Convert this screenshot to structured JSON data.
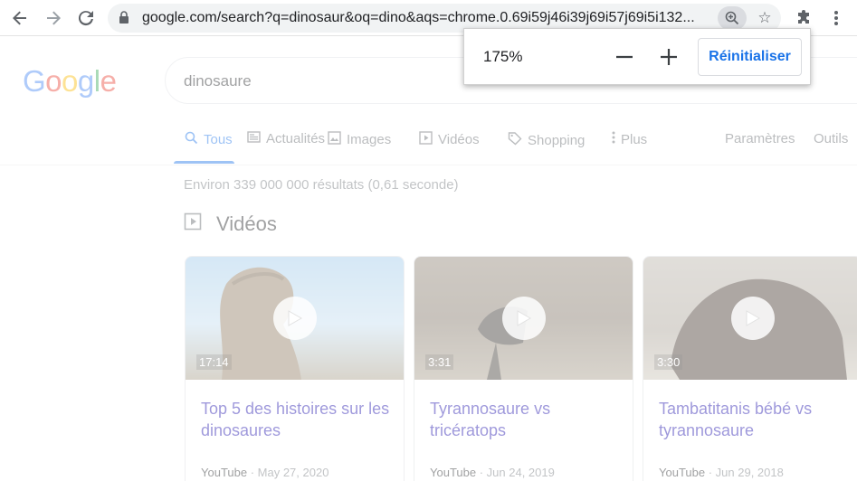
{
  "browser": {
    "url": "google.com/search?q=dinosaur&oq=dino&aqs=chrome.0.69i59j46i39j69i57j69i5i132...",
    "icons": [
      "back-icon",
      "forward-icon",
      "reload-icon",
      "lock-icon",
      "zoom-icon",
      "star-icon",
      "extensions-icon",
      "menu-icon"
    ]
  },
  "zoom_bubble": {
    "level": "175%",
    "reset_label": "Réinitialiser"
  },
  "google": {
    "logo_letters": [
      "G",
      "o",
      "o",
      "g",
      "l",
      "e"
    ],
    "logo_colors": [
      "#4285f4",
      "#ea4335",
      "#fbbc05",
      "#4285f4",
      "#34a853",
      "#ea4335"
    ],
    "query": "dinosaure",
    "tabs": [
      {
        "label": "Tous",
        "icon": "search-icon"
      },
      {
        "label": "Actualités",
        "icon": "news-icon"
      },
      {
        "label": "Images",
        "icon": "image-icon"
      },
      {
        "label": "Vidéos",
        "icon": "video-icon"
      },
      {
        "label": "Shopping",
        "icon": "tag-icon"
      },
      {
        "label": "Plus",
        "icon": "more-vert-icon"
      }
    ],
    "settings_label": "Paramètres",
    "tools_label": "Outils",
    "result_count": "Environ 339 000 000 résultats (0,61 seconde)",
    "videos_section_title": "Vidéos",
    "videos": [
      {
        "duration": "17:14",
        "title": "Top 5 des histoires sur les dinosaures",
        "source": "YouTube",
        "date": "· May 27, 2020"
      },
      {
        "duration": "3:31",
        "title": "Tyrannosaure vs tricératops",
        "source": "YouTube",
        "date": "· Jun 24, 2019"
      },
      {
        "duration": "3:30",
        "title": "Tambatitanis bébé vs tyrannosaure",
        "source": "YouTube",
        "date": "· Jun 29, 2018"
      }
    ]
  },
  "colors": {
    "accent": "#1a73e8",
    "link": "#1a0dab"
  }
}
